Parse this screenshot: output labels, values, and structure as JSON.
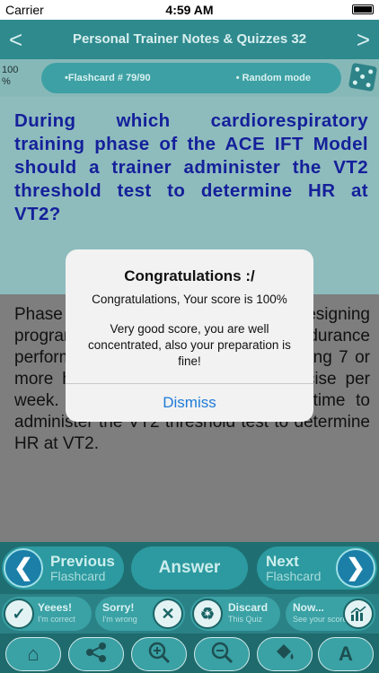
{
  "status_bar": {
    "carrier": "Carrier",
    "time": "4:59 AM"
  },
  "nav": {
    "title": "Personal Trainer Notes & Quizzes 32",
    "back": "<",
    "forward": ">"
  },
  "info": {
    "progress": "100 %",
    "flashcard_label": "•Flashcard #  79/90",
    "mode_label": "• Random mode"
  },
  "question": "During which cardiorespiratory training phase of the ACE IFT Model should a trainer administer the VT2 threshold test to determine HR at VT2?",
  "answer": "Phase 3, performance training, is for designing programs for clients who have endurance performance goals and/or are performing 7 or more hours of cardiorespiratory exercise per week. This is the most appropriate time to administer the VT2 threshold test to determine HR at VT2.",
  "toolbar_main": {
    "previous_line1": "Previous",
    "previous_line2": "Flashcard",
    "answer": "Answer",
    "next_line1": "Next",
    "next_line2": "Flashcard"
  },
  "toolbar_actions": {
    "correct_line1": "Yeees!",
    "correct_line2": "I'm correct",
    "wrong_line1": "Sorry!",
    "wrong_line2": "I'm wrong",
    "discard_line1": "Discard",
    "discard_line2": "This Quiz",
    "score_line1": "Now...",
    "score_line2": "See your score"
  },
  "alert": {
    "title": "Congratulations :/",
    "line1": "Congratulations, Your score is 100%",
    "line2": "Very good score, you are well concentrated, also your preparation is fine!",
    "button": "Dismiss"
  },
  "colors": {
    "question_text": "#15209a",
    "accent": "#2c9aa0",
    "alert_button": "#1d7bd8"
  }
}
